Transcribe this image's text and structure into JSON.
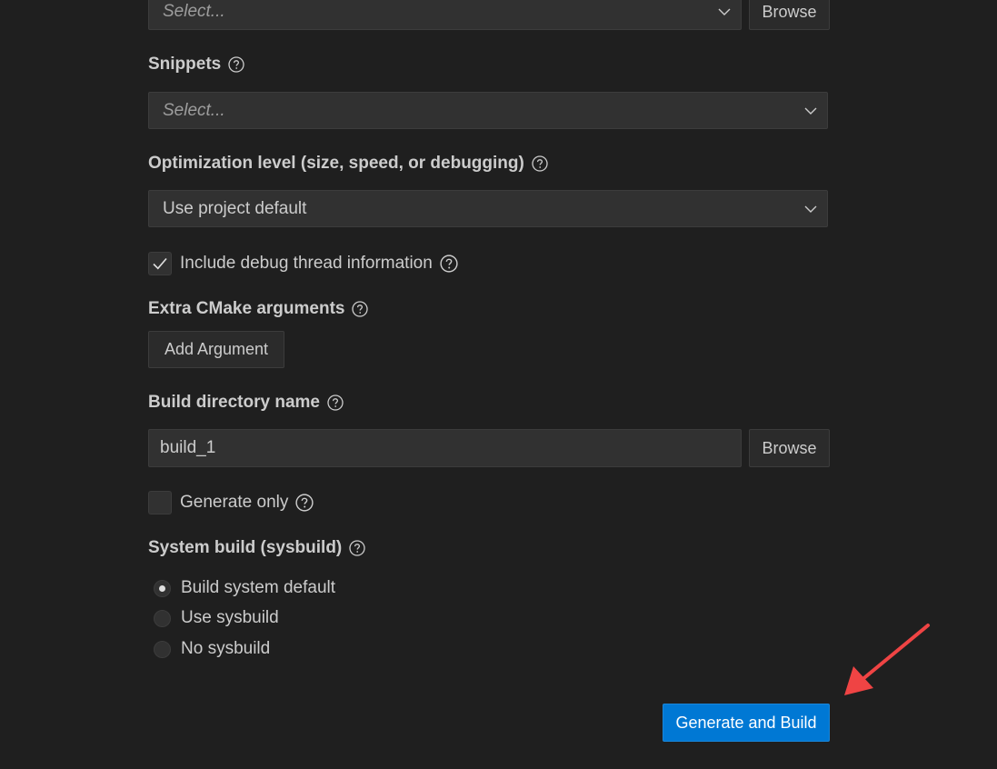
{
  "devicetree": {
    "select_placeholder": "Select...",
    "browse_label": "Browse"
  },
  "snippets": {
    "label": "Snippets",
    "select_placeholder": "Select..."
  },
  "optimization": {
    "label": "Optimization level (size, speed, or debugging)",
    "selected_value": "Use project default"
  },
  "debug_thread": {
    "label": "Include debug thread information",
    "checked": true
  },
  "cmake_args": {
    "label": "Extra CMake arguments",
    "add_button_label": "Add Argument"
  },
  "build_dir": {
    "label": "Build directory name",
    "value": "build_1",
    "browse_label": "Browse"
  },
  "generate_only": {
    "label": "Generate only",
    "checked": false
  },
  "sysbuild": {
    "label": "System build (sysbuild)",
    "options": [
      {
        "label": "Build system default",
        "selected": true
      },
      {
        "label": "Use sysbuild",
        "selected": false
      },
      {
        "label": "No sysbuild",
        "selected": false
      }
    ]
  },
  "actions": {
    "generate_build_label": "Generate and Build"
  },
  "annotation": {
    "arrow_color": "#ef4444"
  },
  "colors": {
    "background": "#1f1f1f",
    "primary_button": "#0078d4"
  }
}
